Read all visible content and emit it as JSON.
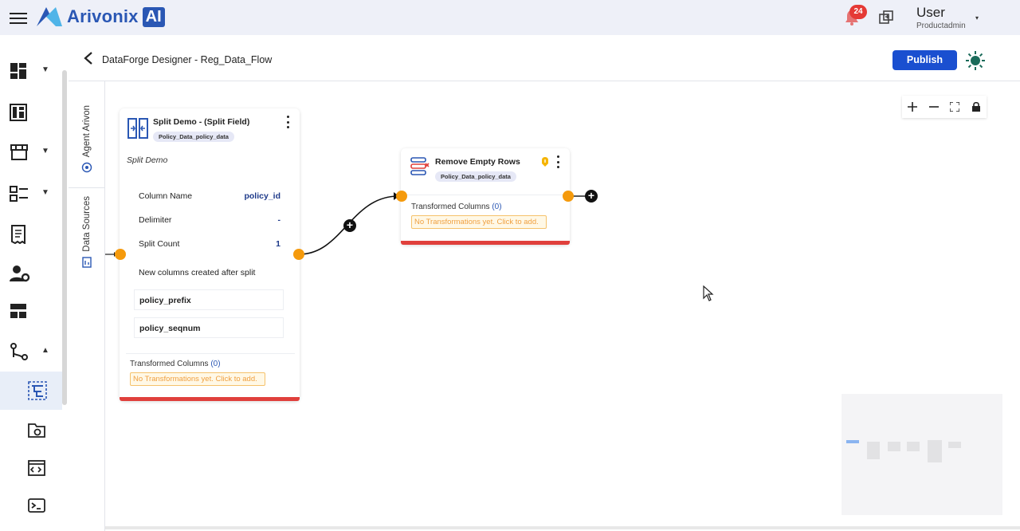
{
  "topbar": {
    "logo_text": "Arivonix",
    "logo_badge": "AI",
    "notification_count": "24",
    "user_name": "User",
    "user_role": "Productadmin"
  },
  "sidebar": {
    "items": [
      {
        "icon": "dashboard-icon",
        "has_caret": true
      },
      {
        "icon": "columns-icon",
        "has_caret": false
      },
      {
        "icon": "store-icon",
        "has_caret": true
      },
      {
        "icon": "checklist-icon",
        "has_caret": true
      },
      {
        "icon": "receipt-icon",
        "has_caret": false
      },
      {
        "icon": "user-settings-icon",
        "has_caret": false
      },
      {
        "icon": "layout-icon",
        "has_caret": false
      },
      {
        "icon": "workflow-icon",
        "has_caret": true,
        "expanded": true
      },
      {
        "icon": "dataforge-icon",
        "active": true
      },
      {
        "icon": "folder-settings-icon"
      },
      {
        "icon": "code-window-icon"
      },
      {
        "icon": "terminal-icon"
      }
    ]
  },
  "header": {
    "title": "DataForge Designer - Reg_Data_Flow",
    "publish_label": "Publish"
  },
  "rail": {
    "agent_tab": "Agent Arivon",
    "data_tab": "Data Sources"
  },
  "nodes": {
    "split": {
      "title": "Split Demo - (Split Field)",
      "tag": "Policy_Data_policy_data",
      "subtitle": "Split Demo",
      "rows": [
        {
          "label": "Column Name",
          "value": "policy_id"
        },
        {
          "label": "Delimiter",
          "value": "-"
        },
        {
          "label": "Split Count",
          "value": "1"
        }
      ],
      "new_columns_label": "New columns created after split",
      "new_columns": [
        "policy_prefix",
        "policy_seqnum"
      ],
      "transformed_label": "Transformed Columns",
      "transformed_count": "(0)",
      "warning": "No Transformations yet. Click to add."
    },
    "remove": {
      "title": "Remove Empty Rows",
      "tag": "Policy_Data_policy_data",
      "transformed_label": "Transformed Columns",
      "transformed_count": "(0)",
      "warning": "No Transformations yet. Click to add."
    }
  },
  "colors": {
    "accent": "#1a4fd0",
    "port": "#f59a0c",
    "error_bar": "#e0403c",
    "warning_text": "#f0a040"
  }
}
